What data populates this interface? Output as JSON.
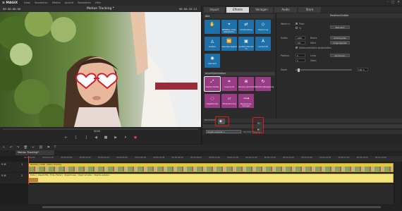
{
  "app": {
    "logo": "≡ MAGIX",
    "menu": [
      "Datei",
      "Bearbeiten",
      "Effekte",
      "Ansicht",
      "Bearbeiten",
      "Hilfe"
    ],
    "window_controls": [
      "–",
      "□",
      "✕"
    ]
  },
  "preview": {
    "timecode_left": "00:00:00:00",
    "title": "Motion Tracking *",
    "timecode_right": "00:00:20:14",
    "scrub_time": "00:00",
    "buttons": [
      "⇤",
      "[",
      "]",
      "◀",
      "■",
      "▶",
      "⏵",
      "●"
    ]
  },
  "media_pool": {
    "tabs": [
      "Import",
      "Effekte",
      "Vorlagen",
      "Audio",
      "Store"
    ],
    "active_tab": "Effekte"
  },
  "effects": {
    "header": "Alle",
    "section2": "Ansicht/Animation",
    "tiles_row1": [
      {
        "label": "",
        "icon": "hand-icon"
      },
      {
        "label": "NEWBlue Video Stabilization",
        "icon": "stabilize-icon"
      },
      {
        "label": "Umwandlung",
        "icon": "convert-icon"
      },
      {
        "label": "Verzerrung",
        "icon": "distort-icon"
      }
    ],
    "tiles_row2": [
      {
        "label": "Schärfe",
        "icon": "sharpen-icon"
      },
      {
        "label": "Geschwindigkeit",
        "icon": "speed-icon"
      },
      {
        "label": "proDAD Mercalli V4",
        "icon": "mercalli-icon"
      },
      {
        "label": "Laufschrift",
        "icon": "text-scroll-icon"
      }
    ],
    "tiles_row3": [
      {
        "label": "Standard",
        "icon": "standard-icon"
      }
    ],
    "tiles_anim_row1": [
      {
        "label": "Position/Größe",
        "icon": "position-icon"
      },
      {
        "label": "Ausschnitt",
        "icon": "crop-icon"
      },
      {
        "label": "Kamera-/Zoomfahrt",
        "icon": "zoom-icon"
      },
      {
        "label": "Rotation/Spiegelung",
        "icon": "rotate-icon"
      }
    ],
    "tiles_anim_row2": [
      {
        "label": "Objektkontur",
        "icon": "contour-icon"
      },
      {
        "label": "3D-Verformung",
        "icon": "3d-icon"
      },
      {
        "label": "Bewegungs-Vorlagen",
        "icon": "motion-template-icon"
      }
    ]
  },
  "position_panel": {
    "title": "Position/Größe",
    "mode_label": "Werte in",
    "mode_options": [
      "Pixel",
      "%"
    ],
    "button_reset": "Standard",
    "size_label": "Größe",
    "size_w": "1280",
    "size_h": "720",
    "lbl_breite": "Breite",
    "lbl_hoehe": "Höhe",
    "btn_fullscreen": "Vollbildgröße",
    "btn_original": "Originalgröße",
    "chk_ratio": "Seitenverhältnis beibehalten",
    "pos_label": "Position",
    "pos_x": "0",
    "pos_y": "0",
    "lbl_links": "Links",
    "lbl_oben": "Oben",
    "btn_center": "Zentrieren",
    "zoom_label": "Zoom",
    "zoom_value": "100 %"
  },
  "keyframes": {
    "ruler_label": "00:00:00:00",
    "select_label": "Objekt erstellen ▾",
    "title_center": "MOTION TRACKING"
  },
  "timeline": {
    "tab": "Motion Tracking*",
    "ruler_ticks": [
      "00:00:00:00",
      "00:00:01:00",
      "00:00:02:00",
      "00:00:03:00",
      "00:00:04:00",
      "00:00:05:00",
      "00:00:06:00",
      "00:00:07:00",
      "00:00:08:00",
      "00:00:09:00",
      "00:00:10:00",
      "00:00:11:00",
      "00:00:12:00",
      "00:00:13:00",
      "00:00:14:00",
      "00:00:15:00",
      "00:00:16:00",
      "00:00:17:00",
      "00:00:18:00",
      "00:00:19:00"
    ],
    "track1_name": "S M",
    "track1_num": "1",
    "track2_name": "S M",
    "track2_num": "2",
    "track1_label": "Mädchen_1.MP4 · Motion Tracking",
    "track2_label": "Brille_1_Objekt.PNG · Brille  (Fehler) · Objektmaske · Objekt erhalten · Objekte erstellen"
  }
}
